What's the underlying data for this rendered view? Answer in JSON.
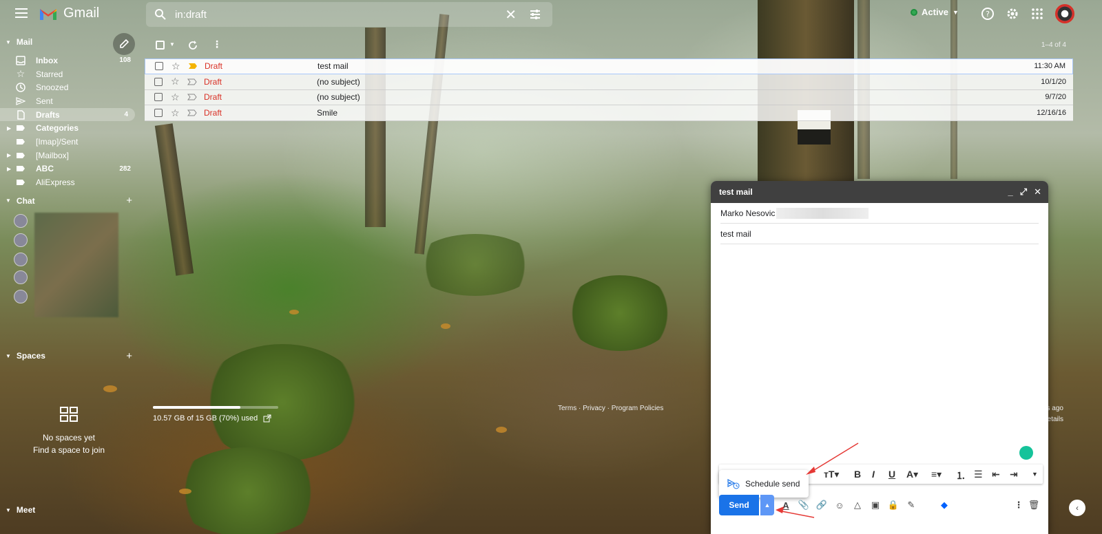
{
  "topbar": {
    "app_name": "Gmail",
    "search_value": "in:draft",
    "status_label": "Active"
  },
  "sidebar": {
    "mail_header": "Mail",
    "items": [
      {
        "label": "Inbox",
        "count": "108",
        "bold": true
      },
      {
        "label": "Starred",
        "count": ""
      },
      {
        "label": "Snoozed",
        "count": ""
      },
      {
        "label": "Sent",
        "count": ""
      },
      {
        "label": "Drafts",
        "count": "4",
        "bold": true,
        "selected": true
      },
      {
        "label": "Categories",
        "count": "",
        "bold": true
      },
      {
        "label": "[Imap]/Sent",
        "count": ""
      },
      {
        "label": "[Mailbox]",
        "count": ""
      },
      {
        "label": "ABC",
        "count": "282",
        "bold": true
      },
      {
        "label": "AliExpress",
        "count": ""
      }
    ],
    "chat_header": "Chat",
    "spaces_header": "Spaces",
    "spaces_empty": "No spaces yet",
    "spaces_find": "Find a space to join",
    "meet_header": "Meet"
  },
  "list": {
    "pager": "1–4 of 4",
    "rows": [
      {
        "sender": "Draft",
        "subject": "test mail",
        "date": "11:30 AM"
      },
      {
        "sender": "Draft",
        "subject": "(no subject)",
        "date": "10/1/20"
      },
      {
        "sender": "Draft",
        "subject": "(no subject)",
        "date": "9/7/20"
      },
      {
        "sender": "Draft",
        "subject": "Smile",
        "date": "12/16/16"
      }
    ]
  },
  "storage": {
    "used_fraction": 0.7,
    "text": "10.57 GB of 15 GB (70%) used"
  },
  "footer": {
    "links": "Terms · Privacy · Program Policies",
    "activity": "s ago",
    "details": "etails"
  },
  "compose": {
    "title": "test mail",
    "to": "Marko Nesovic",
    "subject": "test mail",
    "schedule_label": "Schedule send",
    "send_label": "Send"
  },
  "colors": {
    "accent": "#1a73e8",
    "draft_red": "#d93025",
    "active_green": "#34a853"
  }
}
